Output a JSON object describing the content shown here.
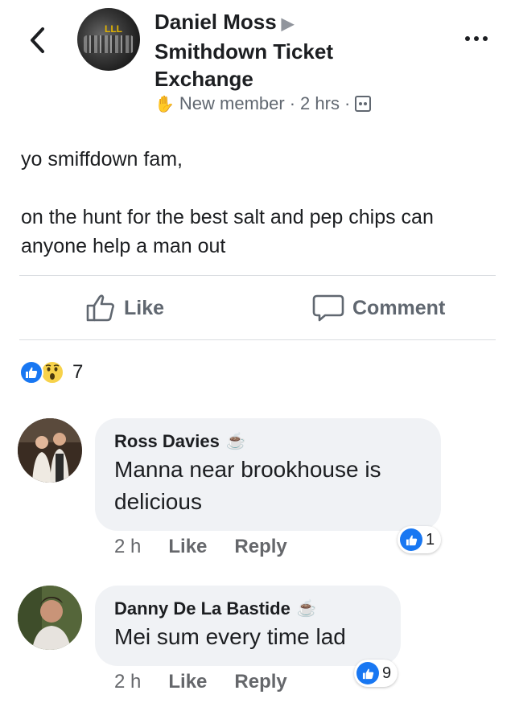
{
  "post": {
    "author": "Daniel Moss",
    "group": "Smithdown Ticket Exchange",
    "badge": "New member",
    "time": "2 hrs",
    "separator": "·",
    "paragraphs": [
      "yo smiffdown fam,",
      "on the hunt for the best salt and pep chips can anyone help a man out"
    ]
  },
  "actions": {
    "like": "Like",
    "comment": "Comment"
  },
  "reactions": {
    "count": "7",
    "types": [
      "like",
      "wow"
    ]
  },
  "comments": [
    {
      "name": "Ross Davies",
      "text": "Manna near brookhouse is delicious",
      "time": "2 h",
      "like": "Like",
      "reply": "Reply",
      "reaction_count": "1"
    },
    {
      "name": "Danny De La Bastide",
      "text": "Mei sum every time lad",
      "time": "2 h",
      "like": "Like",
      "reply": "Reply",
      "reaction_count": "9"
    }
  ],
  "colors": {
    "accent": "#1877f2",
    "text": "#1c1e21",
    "muted": "#606770",
    "bubble": "#f0f2f5"
  }
}
